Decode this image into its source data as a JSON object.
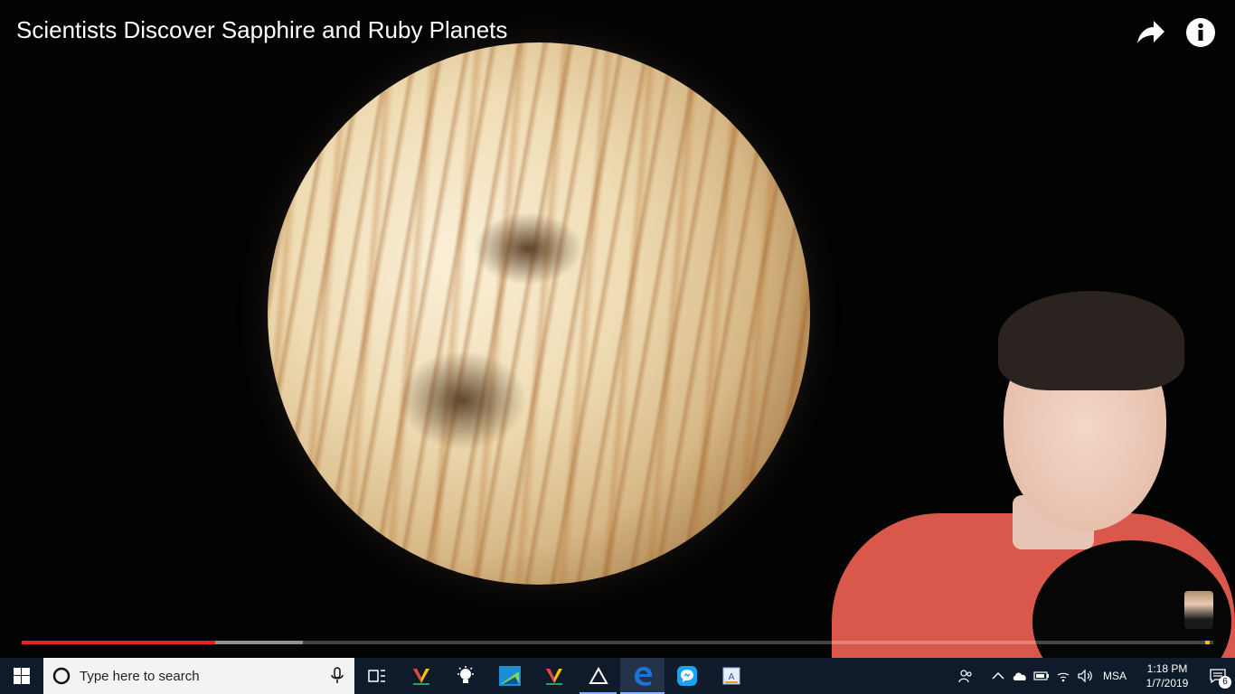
{
  "video": {
    "title": "Scientists Discover Sapphire and Ruby Planets",
    "progress": {
      "played_fraction": 0.162,
      "buffered_fraction": 0.236
    }
  },
  "icons": {
    "share": "share-icon",
    "info": "info-icon",
    "start": "windows-logo-icon",
    "search": "cortana-circle-icon",
    "mic": "microphone-icon"
  },
  "taskbar": {
    "search_placeholder": "Type here to search",
    "apps": [
      {
        "name": "task-view",
        "state": "idle"
      },
      {
        "name": "app-v-logo",
        "state": "idle"
      },
      {
        "name": "bulb-app",
        "state": "idle"
      },
      {
        "name": "image-app",
        "state": "idle"
      },
      {
        "name": "app-v-logo-2",
        "state": "idle"
      },
      {
        "name": "triangle-app",
        "state": "open"
      },
      {
        "name": "edge",
        "state": "active"
      },
      {
        "name": "chat-app",
        "state": "idle"
      },
      {
        "name": "doc-app",
        "state": "idle"
      }
    ],
    "tray": {
      "language": "MSA",
      "time": "1:18 PM",
      "date": "1/7/2019",
      "notification_count": "6"
    }
  },
  "colors": {
    "progress_played": "#e52222",
    "taskbar_bg": "#0f1a2a",
    "edge_blue": "#1e73d6"
  }
}
